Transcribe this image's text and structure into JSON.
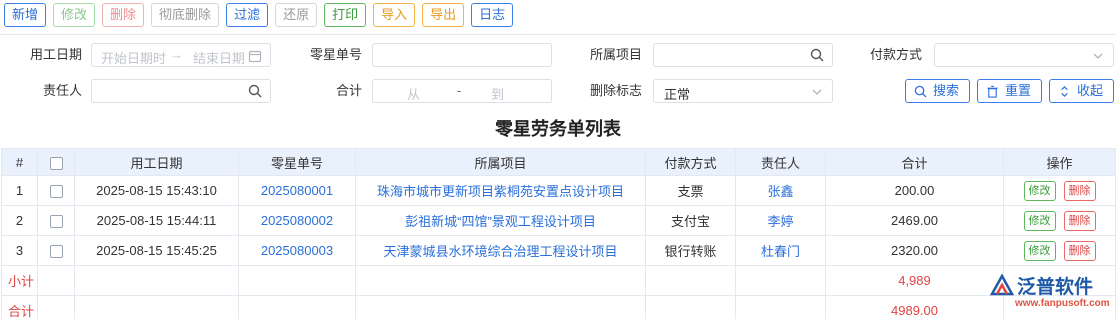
{
  "toolbar": {
    "add": "新增",
    "edit": "修改",
    "delete": "删除",
    "purge": "彻底删除",
    "filter": "过滤",
    "restore": "还原",
    "print": "打印",
    "import": "导入",
    "export": "导出",
    "log": "日志"
  },
  "filters": {
    "work_date_label": "用工日期",
    "start_placeholder": "开始日期时",
    "end_placeholder": "结束日期",
    "odd_no_label": "零星单号",
    "project_label": "所属项目",
    "payment_label": "付款方式",
    "owner_label": "责任人",
    "total_label": "合计",
    "total_from": "从",
    "total_dash": "-",
    "total_to": "到",
    "delete_flag_label": "删除标志",
    "delete_flag_value": "正常",
    "search_btn": "搜索",
    "reset_btn": "重置",
    "collapse_btn": "收起"
  },
  "title": "零星劳务单列表",
  "table": {
    "headers": [
      "#",
      "",
      "用工日期",
      "零星单号",
      "所属项目",
      "付款方式",
      "责任人",
      "合计",
      "操作"
    ],
    "rows": [
      {
        "idx": "1",
        "date": "2025-08-15 15:43:10",
        "no": "2025080001",
        "project": "珠海市城市更新项目紫桐苑安置点设计项目",
        "payment": "支票",
        "owner": "张鑫",
        "total": "200.00"
      },
      {
        "idx": "2",
        "date": "2025-08-15 15:44:11",
        "no": "2025080002",
        "project": "彭祖新城“四馆”景观工程设计项目",
        "payment": "支付宝",
        "owner": "李婷",
        "total": "2469.00"
      },
      {
        "idx": "3",
        "date": "2025-08-15 15:45:25",
        "no": "2025080003",
        "project": "天津蒙城县水环境综合治理工程设计项目",
        "payment": "银行转账",
        "owner": "杜春门",
        "total": "2320.00"
      }
    ],
    "edit_label": "修改",
    "delete_label": "删除",
    "subtotal_label": "小计",
    "subtotal_value": "4,989",
    "grand_label": "合计",
    "grand_value": "4989.00"
  },
  "watermark": {
    "brand": "泛普软件",
    "site": "www.fanpusoft.com"
  },
  "colors": {
    "primary": "#2a6fdb",
    "success": "#3a9a3a",
    "danger": "#e04444",
    "warning": "#e89a1b",
    "header_bg": "#e9f1fd"
  }
}
